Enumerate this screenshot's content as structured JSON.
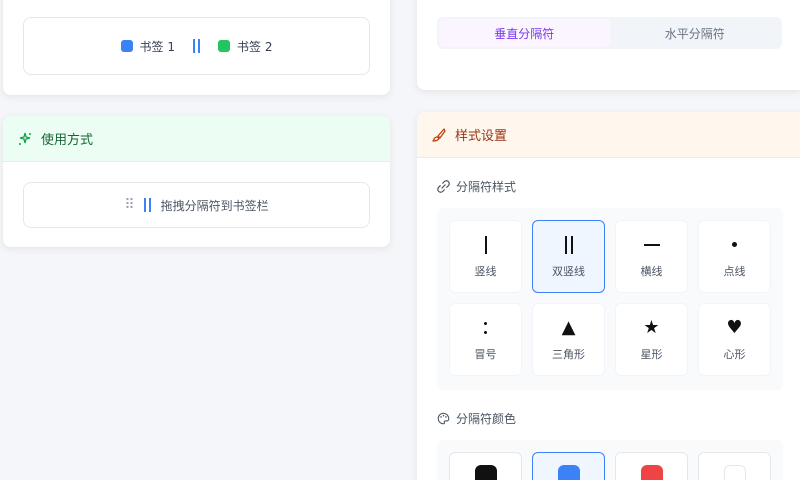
{
  "preview": {
    "bookmark1": {
      "label": "书签 1",
      "color": "#3b82f6"
    },
    "bookmark2": {
      "label": "书签 2",
      "color": "#22c55e"
    },
    "separator_color": "#3b82f6"
  },
  "usage": {
    "title": "使用方式",
    "hint": "拖拽分隔符到书签栏"
  },
  "tabs": [
    {
      "label": "垂直分隔符",
      "active": true
    },
    {
      "label": "水平分隔符",
      "active": false
    }
  ],
  "style_settings": {
    "title": "样式设置",
    "separator_style_label": "分隔符样式",
    "separator_color_label": "分隔符颜色",
    "styles": [
      {
        "label": "竖线",
        "icon": "single-line",
        "selected": false
      },
      {
        "label": "双竖线",
        "icon": "double-line",
        "selected": true
      },
      {
        "label": "横线",
        "icon": "horizontal-line",
        "selected": false
      },
      {
        "label": "点线",
        "icon": "dot",
        "selected": false
      },
      {
        "label": "冒号",
        "icon": "colon",
        "selected": false
      },
      {
        "label": "三角形",
        "icon": "triangle",
        "glyph": "▲",
        "selected": false
      },
      {
        "label": "星形",
        "icon": "star",
        "glyph": "★",
        "selected": false
      },
      {
        "label": "心形",
        "icon": "heart",
        "glyph": "♥",
        "selected": false
      }
    ],
    "colors": [
      "#111111",
      "#3b82f6",
      "#ef4444",
      "#ffffff"
    ],
    "selected_color": "#3b82f6"
  }
}
